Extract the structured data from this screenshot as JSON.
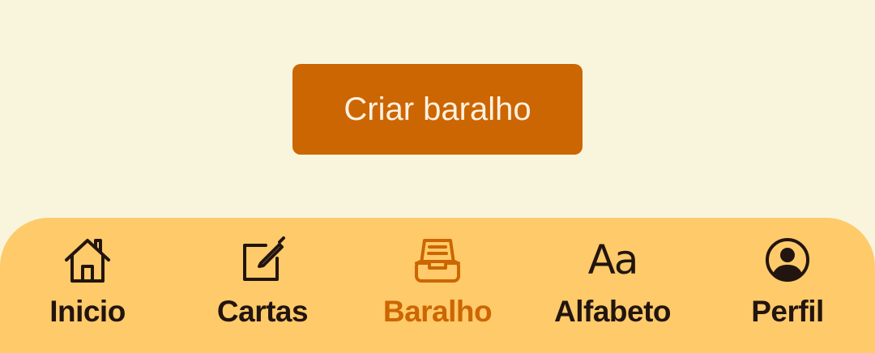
{
  "main": {
    "create_deck_label": "Criar baralho"
  },
  "bottom_nav": {
    "items": [
      {
        "label": "Inicio",
        "icon": "home-icon",
        "active": false
      },
      {
        "label": "Cartas",
        "icon": "edit-icon",
        "active": false
      },
      {
        "label": "Baralho",
        "icon": "inbox-tray-icon",
        "active": true
      },
      {
        "label": "Alfabeto",
        "icon": "text-aa-icon",
        "active": false
      },
      {
        "label": "Perfil",
        "icon": "user-circle-icon",
        "active": false
      }
    ],
    "alphabet_glyph": "Aa"
  },
  "colors": {
    "background": "#f8f5dc",
    "accent": "#cc6602",
    "nav_background": "#ffca6a",
    "text_dark": "#22150f"
  }
}
